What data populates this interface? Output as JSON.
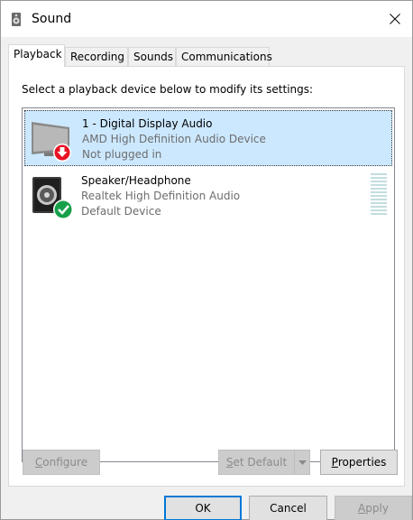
{
  "window": {
    "title": "Sound"
  },
  "tabs": [
    {
      "label": "Playback"
    },
    {
      "label": "Recording"
    },
    {
      "label": "Sounds"
    },
    {
      "label": "Communications"
    }
  ],
  "panel": {
    "instructions": "Select a playback device below to modify its settings:"
  },
  "devices": [
    {
      "name": "1 - Digital Display Audio",
      "driver": "AMD High Definition Audio Device",
      "status": "Not plugged in",
      "icon": "monitor-speaker-icon",
      "badge": "red-down-arrow-icon"
    },
    {
      "name": "Speaker/Headphone",
      "driver": "Realtek High Definition Audio",
      "status": "Default Device",
      "icon": "speaker-icon",
      "badge": "green-check-icon"
    }
  ],
  "panel_buttons": {
    "configure_prefix": "",
    "configure_ul": "C",
    "configure_rest": "onfigure",
    "set_default_ul": "S",
    "set_default_rest": "et Default",
    "properties_ul": "P",
    "properties_rest": "roperties"
  },
  "dialog_buttons": {
    "ok": "OK",
    "cancel": "Cancel",
    "apply_ul": "A",
    "apply_rest": "pply"
  },
  "colors": {
    "selection": "#cce8ff",
    "accent": "#0078d7",
    "check": "#17a04a",
    "alert": "#e81123"
  }
}
